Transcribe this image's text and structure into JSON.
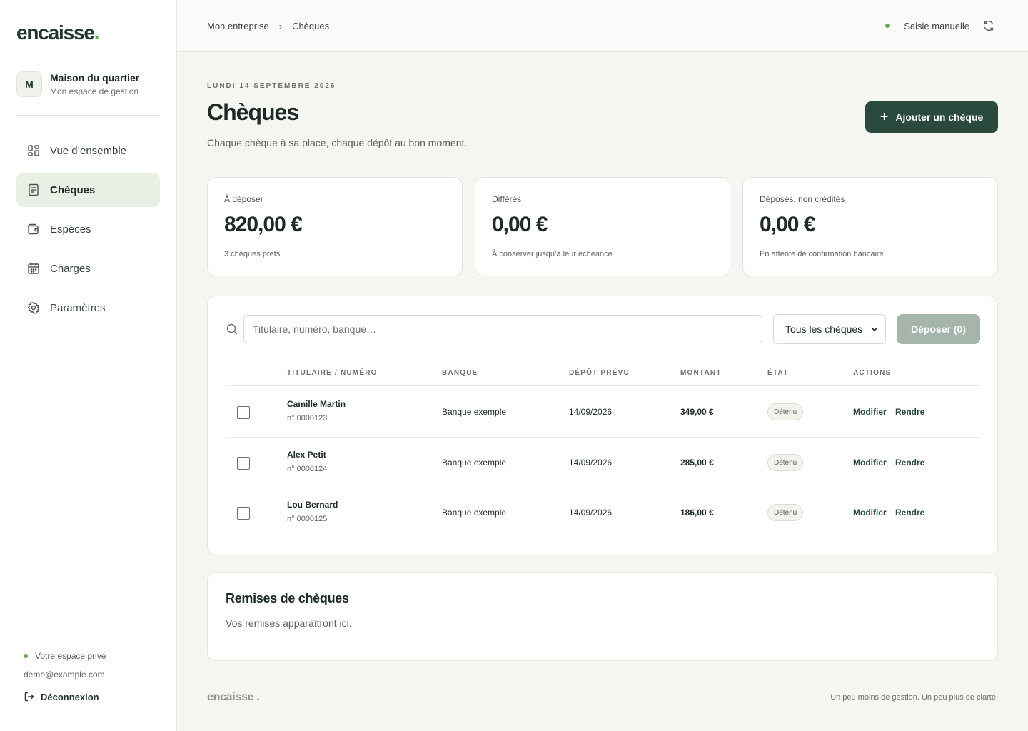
{
  "sidebar": {
    "logo_text": "encaisse",
    "logo_dot": ".",
    "org": {
      "initial": "M",
      "name": "Maison du quartier",
      "subtitle": "Mon espace de gestion"
    },
    "nav": [
      {
        "label": "Vue d’ensemble",
        "icon": "grid-icon",
        "active": false
      },
      {
        "label": "Chèques",
        "icon": "document-icon",
        "active": true
      },
      {
        "label": "Espèces",
        "icon": "wallet-icon",
        "active": false
      },
      {
        "label": "Charges",
        "icon": "calendar-icon",
        "active": false
      },
      {
        "label": "Paramètres",
        "icon": "gear-icon",
        "active": false
      }
    ],
    "footer": {
      "private_label": "Votre espace privé",
      "email": "demo@example.com",
      "logout_label": "Déconnexion"
    }
  },
  "topbar": {
    "breadcrumb": [
      "Mon entreprise",
      "Chèques"
    ],
    "breadcrumb_sep": "›",
    "sync_label": "Saisie manuelle"
  },
  "page": {
    "date": "Lundi 14 septembre 2026",
    "title": "Chèques",
    "subtitle": "Chaque chèque à sa place, chaque dépôt au bon moment.",
    "add_button": "Ajouter un chèque"
  },
  "cards": [
    {
      "label": "À déposer",
      "value": "820,00 €",
      "sub": "3 chèques prêts"
    },
    {
      "label": "Différés",
      "value": "0,00 €",
      "sub": "À conserver jusqu’à leur échéance"
    },
    {
      "label": "Déposés, non crédités",
      "value": "0,00 €",
      "sub": "En attente de confirmation bancaire"
    }
  ],
  "table": {
    "search_placeholder": "Titulaire, numéro, banque…",
    "filter_value": "Tous les chèques",
    "deposit_button": "Déposer (0)",
    "headers": {
      "holder": "Titulaire / numéro",
      "bank": "Banque",
      "date": "Dépôt prévu",
      "amount": "Montant",
      "state": "État",
      "actions": "Actions"
    },
    "rows": [
      {
        "name": "Camille Martin",
        "number": "n° 0000123",
        "bank": "Banque exemple",
        "date": "14/09/2026",
        "amount": "349,00 €",
        "state": "Détenu",
        "edit": "Modifier",
        "return": "Rendre"
      },
      {
        "name": "Alex Petit",
        "number": "n° 0000124",
        "bank": "Banque exemple",
        "date": "14/09/2026",
        "amount": "285,00 €",
        "state": "Détenu",
        "edit": "Modifier",
        "return": "Rendre"
      },
      {
        "name": "Lou Bernard",
        "number": "n° 0000125",
        "bank": "Banque exemple",
        "date": "14/09/2026",
        "amount": "186,00 €",
        "state": "Détenu",
        "edit": "Modifier",
        "return": "Rendre"
      }
    ]
  },
  "remises": {
    "title": "Remises de chèques",
    "empty": "Vos remises apparaîtront ici."
  },
  "footer": {
    "logo": "encaisse .",
    "tagline": "Un peu moins de gestion. Un peu plus de clarté."
  },
  "colors": {
    "brand": "#2a4a3e",
    "accent": "#6aa84f",
    "active_nav": "#e8efe4",
    "disabled_button": "#a5b5ac"
  }
}
